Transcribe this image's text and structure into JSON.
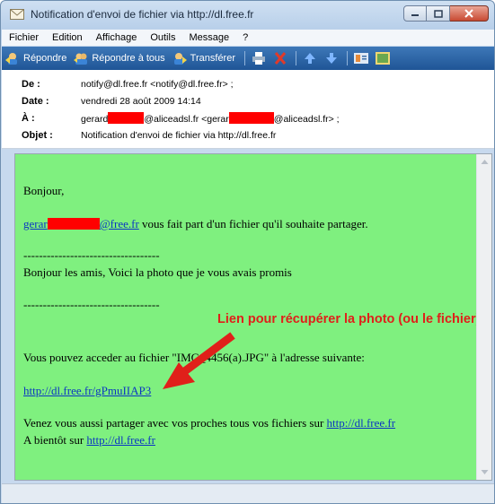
{
  "window": {
    "title": "Notification d'envoi de fichier via http://dl.free.fr"
  },
  "menu": [
    "Fichier",
    "Edition",
    "Affichage",
    "Outils",
    "Message",
    "?"
  ],
  "toolbar": {
    "reply": "Répondre",
    "reply_all": "Répondre à tous",
    "forward": "Transférer"
  },
  "headers": {
    "from_label": "De :",
    "from_value": "notify@dl.free.fr <notify@dl.free.fr> ;",
    "date_label": "Date :",
    "date_value": "vendredi 28 août 2009 14:14",
    "to_label": "À :",
    "to_p1": "gerard",
    "to_p2": "@aliceadsl.fr <gerar",
    "to_p3": "@aliceadsl.fr> ;",
    "subject_label": "Objet :",
    "subject_value": "Notification d'envoi de fichier via http://dl.free.fr"
  },
  "body": {
    "greeting": "Bonjour,",
    "sender_link_start": "gerar",
    "sender_link_end": "@free.fr",
    "share_text": " vous fait part d'un fichier qu'il souhaite partager.",
    "separator1": "-----------------------------------",
    "message": "Bonjour les amis, Voici la photo que je vous avais promis",
    "separator2": "-----------------------------------",
    "annotation": "Lien pour récupérer la photo (ou le fichier)",
    "access_text": "Vous pouvez acceder au fichier \"IMG_4456(a).JPG\" à l'adresse suivante:",
    "file_link": "http://dl.free.fr/gPmuIIAP3",
    "share_invite": "Venez vous aussi partager avec vos proches tous vos fichiers sur ",
    "share_invite_link": "http://dl.free.fr",
    "goodbye": "A bientôt sur ",
    "goodbye_link": "http://dl.free.fr"
  },
  "colors": {
    "body_background": "#7ff07f",
    "link": "#0b36c2",
    "annotation": "#e0201a",
    "redaction": "#ff0000"
  }
}
